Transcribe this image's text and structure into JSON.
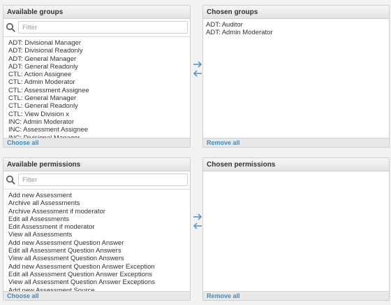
{
  "groups": {
    "available": {
      "title": "Available groups",
      "filter_placeholder": "Filter",
      "items": [
        "ADT: Divisional Manager",
        "ADT: Divisional Readonly",
        "ADT: General Manager",
        "ADT: General Readonly",
        "CTL: Action Assignee",
        "CTL: Admin Moderator",
        "CTL: Assessment Assignee",
        "CTL: General Manager",
        "CTL: General Readonly",
        "CTL: View Division x",
        "INC: Admin Moderator",
        "INC: Assessment Assignee",
        "INC: Divisional Manager"
      ],
      "footer_link": "Choose all"
    },
    "chosen": {
      "title": "Chosen groups",
      "items": [
        "ADT: Auditor",
        "ADT: Admin Moderator"
      ],
      "footer_link": "Remove all"
    }
  },
  "permissions": {
    "available": {
      "title": "Available permissions",
      "filter_placeholder": "Filter",
      "items": [
        "Add new Assessment",
        "Archive all Assessments",
        "Archive Assessment if moderator",
        "Edit all Assessments",
        "Edit Assessment if moderator",
        "View all Assessments",
        "Add new Assessment Question Answer",
        "Edit all Assessment Question Answers",
        "View all Assessment Question Answers",
        "Add new Assessment Question Answer Exception",
        "Edit all Assessment Question Answer Exceptions",
        "View all Assessment Question Answer Exceptions",
        "Add new Assessment Source"
      ],
      "footer_link": "Choose all"
    },
    "chosen": {
      "title": "Chosen permissions",
      "items": [],
      "footer_link": "Remove all"
    }
  },
  "colors": {
    "link": "#3f8bbd",
    "arrow": "#4a90c2"
  },
  "icons": {
    "filter": "search-icon",
    "add": "arrow-right-icon",
    "remove": "arrow-left-icon"
  }
}
